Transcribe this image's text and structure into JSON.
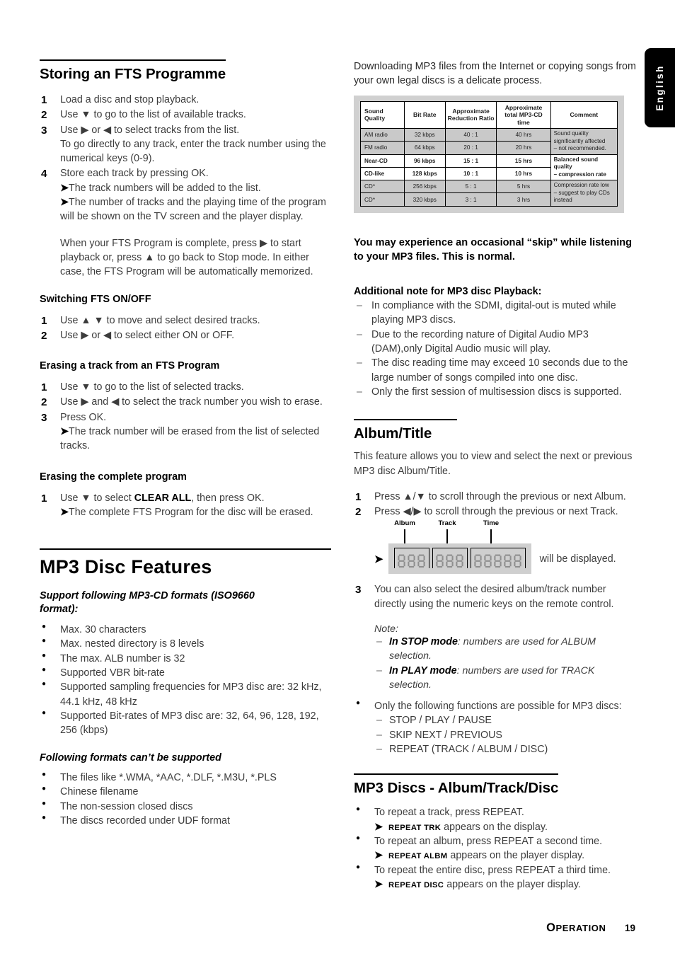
{
  "language_tab": {
    "label": "English"
  },
  "left_column": {
    "section1": {
      "heading": "Storing an FTS Programme",
      "steps": [
        {
          "num": "1",
          "text": "Load a disc and stop playback."
        },
        {
          "num": "2",
          "text": "Use ▼ to go to the list of available tracks."
        },
        {
          "num": "3",
          "text": "Use ▶ or ◀ to select tracks from the list.",
          "sub": "To go directly to any track, enter the track number using the numerical keys (0-9)."
        },
        {
          "num": "4",
          "text": "Store each track by pressing OK.",
          "arrows": [
            "The track numbers will be added to the list.",
            "The number of tracks and the playing time of the program will be shown on the TV screen and the player display."
          ]
        }
      ],
      "paragraph": "When your FTS Program is complete, press ▶ to start playback or, press ▲ to go back to Stop mode. In either case, the FTS Program will be automatically memorized."
    },
    "section2": {
      "heading": "Switching FTS ON/OFF",
      "steps": [
        {
          "num": "1",
          "text": "Use ▲ ▼ to move and select desired tracks."
        },
        {
          "num": "2",
          "text": "Use ▶ or ◀ to select either ON or OFF."
        }
      ]
    },
    "section3": {
      "heading": "Erasing a track from an FTS Program",
      "steps": [
        {
          "num": "1",
          "text": "Use ▼ to go to the list of selected tracks."
        },
        {
          "num": "2",
          "text": "Use ▶ and ◀ to select the track number you wish to erase."
        },
        {
          "num": "3",
          "text": "Press OK.",
          "arrows": [
            "The track number will be erased from the list of selected tracks."
          ]
        }
      ]
    },
    "section4": {
      "heading": "Erasing the complete program",
      "step_num": "1",
      "step_pre": "Use ▼ to select ",
      "step_bold": "CLEAR ALL",
      "step_post": ", then press OK.",
      "arrow": "The complete FTS Program for the disc will be erased."
    },
    "section5": {
      "title": "MP3 Disc Features",
      "sub1": "Support following MP3-CD formats (ISO9660 format):",
      "bullets1": [
        "Max. 30 characters",
        "Max. nested directory is 8 levels",
        "The max. ALB number is 32",
        "Supported VBR bit-rate",
        "Supported sampling frequencies for MP3 disc are: 32 kHz, 44.1 kHz, 48 kHz",
        "Supported Bit-rates of MP3 disc are: 32, 64, 96, 128, 192, 256 (kbps)"
      ],
      "sub2": "Following formats can’t be supported",
      "bullets2": [
        "The files like *.WMA, *AAC, *.DLF, *.M3U, *.PLS",
        "Chinese filename",
        "The non-session closed discs",
        "The discs recorded under UDF format"
      ]
    }
  },
  "right_column": {
    "intro": "Downloading MP3 files from the Internet or copying songs from your own legal discs is a delicate process.",
    "table": {
      "headers": [
        "Sound Quality",
        "Bit Rate",
        "Approximate Reduction Ratio",
        "Approximate total MP3-CD time",
        "Comment"
      ],
      "rows": [
        {
          "quality": "AM radio",
          "bitrate": "32 kbps",
          "ratio": "40 : 1",
          "time": "40 hrs",
          "style": "gray"
        },
        {
          "quality": "FM radio",
          "bitrate": "64 kbps",
          "ratio": "20 : 1",
          "time": "20 hrs",
          "style": "gray"
        },
        {
          "quality": "Near-CD",
          "bitrate": "96 kbps",
          "ratio": "15 : 1",
          "time": "15 hrs",
          "style": "white"
        },
        {
          "quality": "CD-like",
          "bitrate": "128 kbps",
          "ratio": "10 : 1",
          "time": "10 hrs",
          "style": "white"
        },
        {
          "quality": "CD*",
          "bitrate": "256 kbps",
          "ratio": "5 : 1",
          "time": "5 hrs",
          "style": "gray"
        },
        {
          "quality": "CD*",
          "bitrate": "320 kbps",
          "ratio": "3 : 1",
          "time": "3 hrs",
          "style": "gray"
        }
      ],
      "comments": [
        {
          "line1": "Sound quality significantly affected",
          "line2": "– not recommended.",
          "style": "gray"
        },
        {
          "line1": "Balanced sound quality",
          "line2": "– compression rate",
          "style": "white"
        },
        {
          "line1": "Compression rate low",
          "line2": "– suggest to play CDs instead",
          "style": "gray"
        }
      ]
    },
    "skip_notice": "You may experience an occasional “skip” while listening to your MP3 files. This is normal.",
    "additional_note": {
      "heading": "Additional note for MP3 disc Playback:",
      "items": [
        "In compliance with the SDMI, digital-out is muted while playing MP3 discs.",
        "Due to the recording nature of Digital Audio MP3 (DAM),only Digital Audio music will play.",
        "The disc reading time may exceed 10 seconds due to the large number of songs compiled into one disc.",
        "Only the first session of multisession discs is supported."
      ]
    },
    "album_title": {
      "heading": "Album/Title",
      "intro": "This feature allows you to view and select the next or previous MP3 disc Album/Title.",
      "steps": [
        {
          "num": "1",
          "text": "Press ▲/▼ to scroll through the previous or next Album."
        },
        {
          "num": "2",
          "text": "Press ◀/▶ to scroll through the previous or next Track."
        }
      ],
      "display": {
        "labels": [
          "Album",
          "Track",
          "Time"
        ],
        "group_digits": [
          3,
          3,
          5
        ],
        "caption": "will be displayed."
      },
      "step3": {
        "num": "3",
        "text": "You can also select the desired album/track number directly using the numeric keys on the remote control."
      },
      "note_label": "Note:",
      "notes": [
        {
          "bold": "In STOP mode",
          "rest": ": numbers are used for ALBUM selection."
        },
        {
          "bold": "In PLAY mode",
          "rest": ": numbers are used for TRACK selection."
        }
      ],
      "functions_intro": "Only the following functions are possible for MP3 discs:",
      "functions": [
        "STOP / PLAY / PAUSE",
        "SKIP NEXT / PREVIOUS",
        "REPEAT (TRACK / ALBUM / DISC)"
      ]
    },
    "repeat_section": {
      "heading": "MP3 Discs - Album/Track/Disc",
      "items": [
        {
          "bullet": "To repeat a track, press REPEAT.",
          "token": "REPEAT TRK",
          "tail": "appears on the display."
        },
        {
          "bullet": "To repeat an album, press REPEAT a second time.",
          "token": "REPEAT ALBM",
          "tail": "appears on the player display."
        },
        {
          "bullet": "To repeat the entire disc, press REPEAT a third time.",
          "token": "REPEAT DISC",
          "tail": "appears on the player display."
        }
      ]
    }
  },
  "footer": {
    "section": "OPERATION",
    "page": "19"
  }
}
